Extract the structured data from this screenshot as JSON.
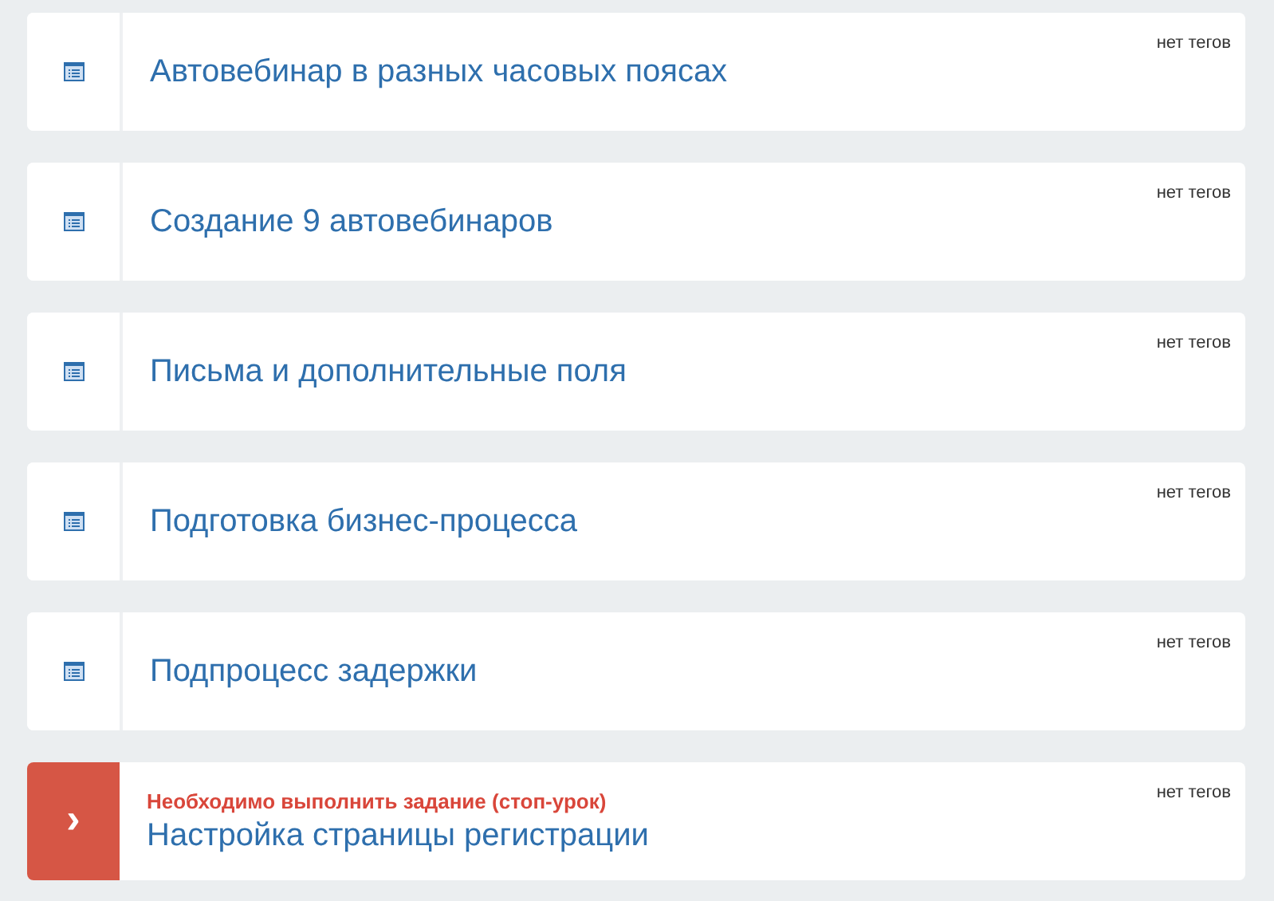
{
  "lessons": [
    {
      "kind": "lesson",
      "title": "Автовебинар в разных часовых поясах",
      "tags": "нет тегов"
    },
    {
      "kind": "lesson",
      "title": "Создание 9 автовебинаров",
      "tags": "нет тегов"
    },
    {
      "kind": "lesson",
      "title": "Письма и дополнительные поля",
      "tags": "нет тегов"
    },
    {
      "kind": "lesson",
      "title": "Подготовка бизнес-процесса",
      "tags": "нет тегов"
    },
    {
      "kind": "lesson",
      "title": "Подпроцесс задержки",
      "tags": "нет тегов"
    },
    {
      "kind": "stop",
      "icon": "›",
      "notice": "Необходимо выполнить задание (стоп-урок)",
      "title": "Настройка страницы регистрации",
      "tags": "нет тегов"
    }
  ]
}
